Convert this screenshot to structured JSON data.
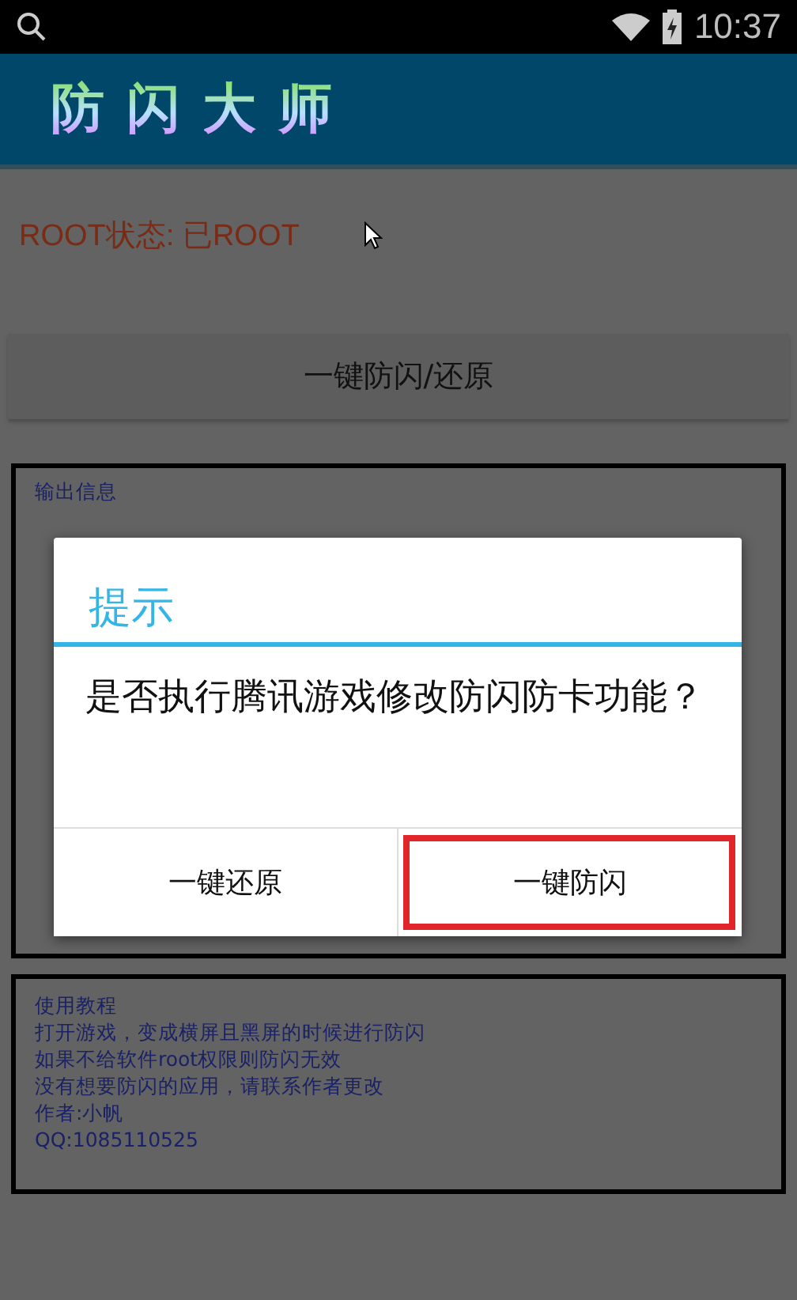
{
  "status_bar": {
    "time": "10:37"
  },
  "app_bar": {
    "title": "防闪大师"
  },
  "root_status": "ROOT状态: 已ROOT",
  "main_button": "一键防闪/还原",
  "output_panel": {
    "label": "输出信息"
  },
  "dialog": {
    "title": "提示",
    "message": "是否执行腾讯游戏修改防闪防卡功能？",
    "buttons": [
      {
        "label": "一键还原",
        "highlighted": false
      },
      {
        "label": "一键防闪",
        "highlighted": true
      }
    ]
  },
  "info_panel": {
    "lines": [
      "使用教程",
      "打开游戏，变成横屏且黑屏的时候进行防闪",
      "如果不给软件root权限则防闪无效",
      "没有想要防闪的应用，请联系作者更改",
      "作者:小帆",
      "QQ:1085110525"
    ]
  }
}
